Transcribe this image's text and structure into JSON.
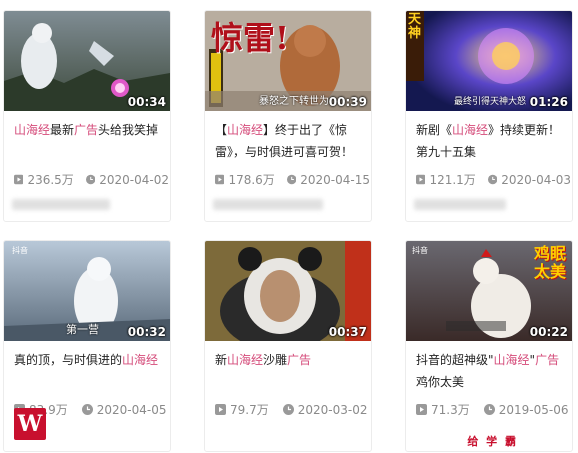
{
  "videos": [
    {
      "duration": "00:34",
      "title_parts": [
        {
          "text": "山海经",
          "hl": true
        },
        {
          "text": "最新",
          "hl": false
        },
        {
          "text": "广告",
          "hl": true
        },
        {
          "text": "头给我笑掉",
          "hl": false
        }
      ],
      "views": "236.5万",
      "date": "2020-04-02"
    },
    {
      "duration": "00:39",
      "overlay_big": "惊雷!",
      "overlay_caption": "暴怒之下转世为",
      "title_parts": [
        {
          "text": "【",
          "hl": false
        },
        {
          "text": "山海经",
          "hl": true
        },
        {
          "text": "】终于出了《惊雷》，与时俱进可喜可贺！",
          "hl": false
        }
      ],
      "views": "178.6万",
      "date": "2020-04-15"
    },
    {
      "duration": "01:26",
      "overlay_big": "天神",
      "overlay_caption": "最终引得天神大怒",
      "title_parts": [
        {
          "text": "新剧《",
          "hl": false
        },
        {
          "text": "山海经",
          "hl": true
        },
        {
          "text": "》持续更新！第九十五集",
          "hl": false
        }
      ],
      "views": "121.1万",
      "date": "2020-04-03"
    },
    {
      "duration": "00:32",
      "overlay_big": "抖音",
      "overlay_caption": "第一营",
      "title_parts": [
        {
          "text": "真的顶，与时俱进的",
          "hl": false
        },
        {
          "text": "山海经",
          "hl": true
        }
      ],
      "views": "83.9万",
      "date": "2020-04-05"
    },
    {
      "duration": "00:37",
      "title_parts": [
        {
          "text": "新",
          "hl": false
        },
        {
          "text": "山海经",
          "hl": true
        },
        {
          "text": "沙雕",
          "hl": false
        },
        {
          "text": "广告",
          "hl": true
        }
      ],
      "views": "79.7万",
      "date": "2020-03-02"
    },
    {
      "duration": "00:22",
      "overlay_big": "鸡眠太美",
      "overlay_caption": "抖音",
      "title_parts": [
        {
          "text": "抖音的超神级\"",
          "hl": false
        },
        {
          "text": "山海经",
          "hl": true
        },
        {
          "text": "\"",
          "hl": false
        },
        {
          "text": "广告",
          "hl": true
        },
        {
          "text": "鸡你太美",
          "hl": false
        }
      ],
      "views": "71.3万",
      "date": "2019-05-06"
    }
  ],
  "icons": {
    "play": "play-count-icon",
    "clock": "clock-icon"
  },
  "brand": {
    "logo_letter": "W",
    "watermark": "给 学 霸"
  },
  "colors": {
    "highlight": "#d54b7a",
    "meta": "#8a8a8a",
    "card_border": "#ececec",
    "logo": "#c8102e"
  }
}
